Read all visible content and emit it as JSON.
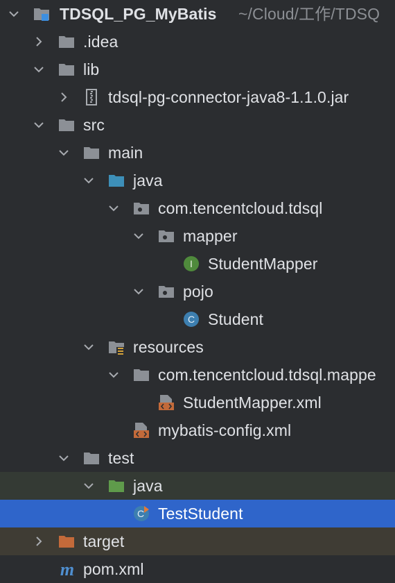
{
  "project": {
    "name": "TDSQL_PG_MyBatis",
    "path": "~/Cloud/工作/TDSQ"
  },
  "tree": [
    {
      "label": "TDSQL_PG_MyBatis",
      "icon": "project-folder-icon",
      "state": "expanded"
    },
    {
      "label": ".idea",
      "icon": "folder-icon",
      "state": "collapsed"
    },
    {
      "label": "lib",
      "icon": "folder-icon",
      "state": "expanded"
    },
    {
      "label": "tdsql-pg-connector-java8-1.1.0.jar",
      "icon": "jar-icon",
      "state": "collapsed"
    },
    {
      "label": "src",
      "icon": "folder-icon",
      "state": "expanded"
    },
    {
      "label": "main",
      "icon": "folder-icon",
      "state": "expanded"
    },
    {
      "label": "java",
      "icon": "source-folder-icon",
      "state": "expanded"
    },
    {
      "label": "com.tencentcloud.tdsql",
      "icon": "package-icon",
      "state": "expanded"
    },
    {
      "label": "mapper",
      "icon": "package-icon",
      "state": "expanded"
    },
    {
      "label": "StudentMapper",
      "icon": "interface-icon",
      "state": "leaf"
    },
    {
      "label": "pojo",
      "icon": "package-icon",
      "state": "expanded"
    },
    {
      "label": "Student",
      "icon": "class-icon",
      "state": "leaf"
    },
    {
      "label": "resources",
      "icon": "resources-folder-icon",
      "state": "expanded"
    },
    {
      "label": "com.tencentcloud.tdsql.mappe",
      "icon": "folder-icon",
      "state": "expanded"
    },
    {
      "label": "StudentMapper.xml",
      "icon": "xml-file-icon",
      "state": "leaf"
    },
    {
      "label": "mybatis-config.xml",
      "icon": "xml-file-icon",
      "state": "leaf"
    },
    {
      "label": "test",
      "icon": "folder-icon",
      "state": "expanded"
    },
    {
      "label": "java",
      "icon": "test-source-folder-icon",
      "state": "expanded"
    },
    {
      "label": "TestStudent",
      "icon": "test-class-icon",
      "state": "selected"
    },
    {
      "label": "target",
      "icon": "excluded-folder-icon",
      "state": "collapsed"
    },
    {
      "label": "pom.xml",
      "icon": "maven-icon",
      "state": "leaf"
    }
  ],
  "colors": {
    "background": "#2b2d30",
    "selection": "#2f65ca",
    "test_highlight": "#343a34",
    "excluded_highlight": "#3f3c34",
    "folder": "#8c9096",
    "source_folder": "#3d8fb8",
    "test_folder": "#5f9b4b",
    "excluded_folder": "#c36a3a",
    "interface": "#4f8a3c",
    "class": "#3d7fb0"
  }
}
